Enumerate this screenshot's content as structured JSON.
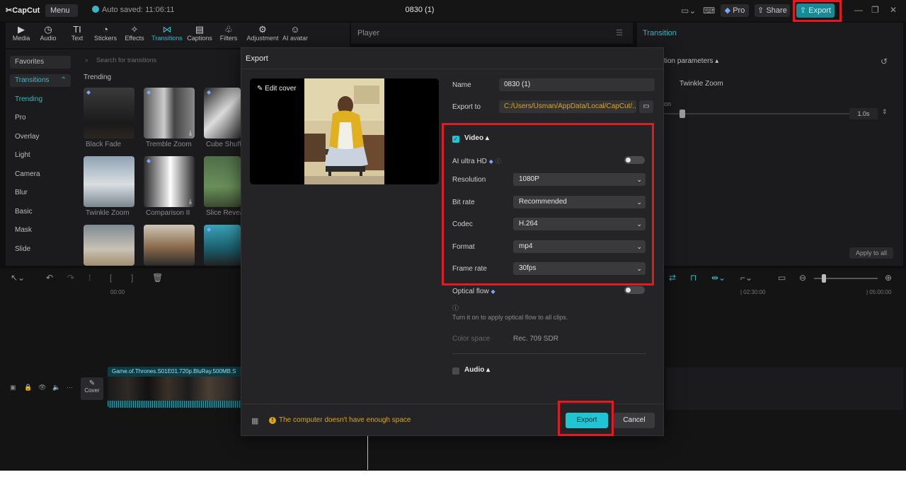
{
  "titlebar": {
    "logo": "CapCut",
    "menu": "Menu ⌄",
    "autosave": "Auto saved: 11:06:11",
    "project_title": "0830 (1)",
    "pro": "Pro",
    "share": "Share",
    "export": "Export"
  },
  "tools": [
    {
      "label": "Media",
      "icon": "media-icon"
    },
    {
      "label": "Audio",
      "icon": "audio-icon"
    },
    {
      "label": "Text",
      "icon": "text-icon"
    },
    {
      "label": "Stickers",
      "icon": "stickers-icon"
    },
    {
      "label": "Effects",
      "icon": "effects-icon"
    },
    {
      "label": "Transitions",
      "icon": "transitions-icon"
    },
    {
      "label": "Captions",
      "icon": "captions-icon"
    },
    {
      "label": "Filters",
      "icon": "filters-icon"
    },
    {
      "label": "Adjustment",
      "icon": "adjustment-icon"
    },
    {
      "label": "AI avatar",
      "icon": "ai-avatar-icon"
    }
  ],
  "sidebar": {
    "favorites": "Favorites",
    "transitions": "Transitions",
    "items": [
      "Trending",
      "Pro",
      "Overlay",
      "Light",
      "Camera",
      "Blur",
      "Basic",
      "Mask",
      "Slide"
    ]
  },
  "library": {
    "search_placeholder": "Search for transitions",
    "heading": "Trending",
    "thumbs": [
      "Black Fade",
      "Tremble Zoom",
      "Cube Shuff",
      "Twinkle Zoom",
      "Comparison II",
      "Slice Revea"
    ]
  },
  "player": {
    "title": "Player"
  },
  "right_panel": {
    "title": "Transition",
    "params": "tion parameters ▴",
    "transition_name": "Twinkle Zoom",
    "duration_partial": "on",
    "duration": "1.0s",
    "apply_all": "Apply to all"
  },
  "timeline": {
    "ruler": [
      "00:00",
      "| 02:30:00",
      "| 05:00:00"
    ],
    "cover": "Cover",
    "clip_name": "Game.of.Thrones.S01E01.720p.BluRay.500MB.S"
  },
  "dialog": {
    "title": "Export",
    "edit_cover": "Edit cover",
    "name_label": "Name",
    "name_value": "0830 (1)",
    "export_to_label": "Export to",
    "export_to_value": "C:/Users/Usman/AppData/Local/CapCut/...",
    "video_section": "Video ▴",
    "ai_ultra_hd": "AI ultra HD",
    "resolution_label": "Resolution",
    "resolution_value": "1080P",
    "bitrate_label": "Bit rate",
    "bitrate_value": "Recommended",
    "codec_label": "Codec",
    "codec_value": "H.264",
    "format_label": "Format",
    "format_value": "mp4",
    "framerate_label": "Frame rate",
    "framerate_value": "30fps",
    "optical_flow": "Optical flow",
    "optical_hint": "Turn it on to apply optical flow to all clips.",
    "color_space_label": "Color space",
    "color_space_value": "Rec. 709 SDR",
    "audio_section": "Audio ▴",
    "warning": "The computer doesn't have enough space",
    "export_btn": "Export",
    "cancel_btn": "Cancel"
  },
  "colors": {
    "accent": "#20c4d3",
    "highlight": "#e01b24",
    "warning": "#d9a521"
  }
}
